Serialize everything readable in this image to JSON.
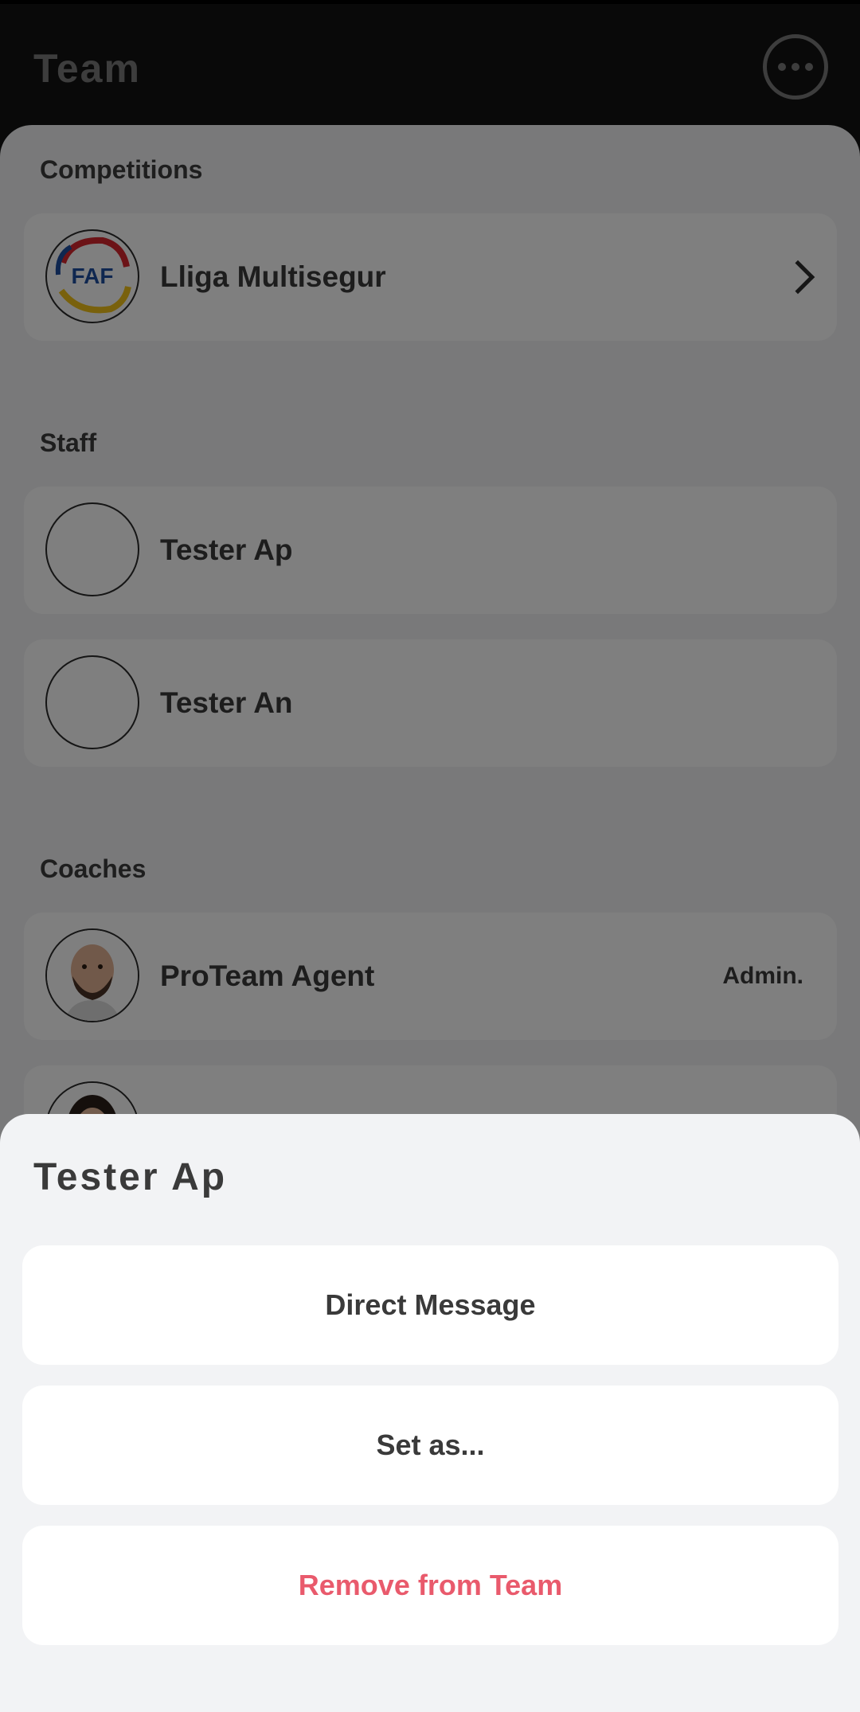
{
  "header": {
    "title": "Team",
    "more_icon": "more-horizontal-circle-icon"
  },
  "sections": {
    "competitions": {
      "title": "Competitions",
      "items": [
        {
          "label": "Lliga Multisegur",
          "logo_text": "FAF"
        }
      ]
    },
    "staff": {
      "title": "Staff",
      "items": [
        {
          "label": "Tester Ap"
        },
        {
          "label": "Tester An"
        }
      ]
    },
    "coaches": {
      "title": "Coaches",
      "items": [
        {
          "label": "ProTeam Agent",
          "role": "Admin."
        }
      ]
    }
  },
  "sheet": {
    "title": "Tester Ap",
    "actions": {
      "direct_message": "Direct Message",
      "set_as": "Set as...",
      "remove": "Remove from Team"
    }
  },
  "colors": {
    "danger": "#e95a6c",
    "header_bg": "#121212",
    "sheet_bg": "#f2f3f5"
  }
}
